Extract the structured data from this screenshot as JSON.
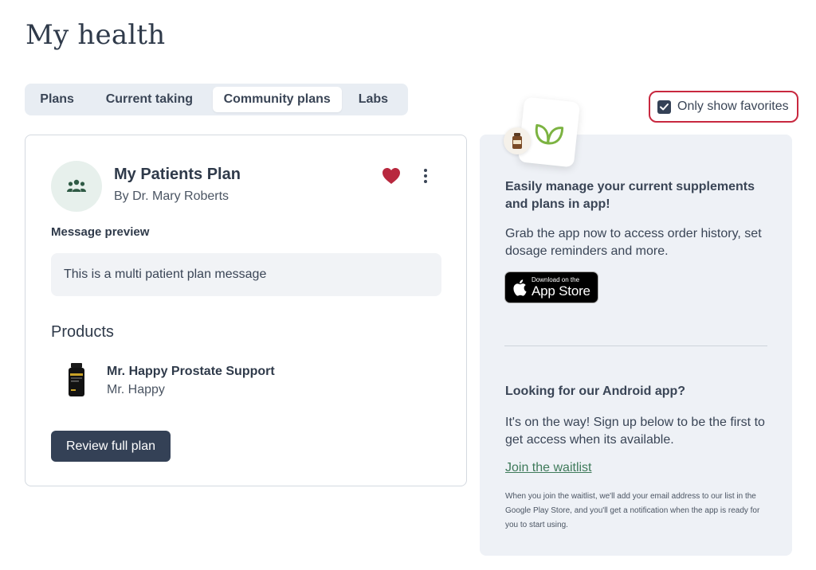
{
  "page": {
    "title": "My health"
  },
  "tabs": [
    {
      "label": "Plans"
    },
    {
      "label": "Current taking"
    },
    {
      "label": "Community plans",
      "active": true
    },
    {
      "label": "Labs"
    }
  ],
  "filter": {
    "label": "Only show favorites",
    "checked": true
  },
  "plan": {
    "name": "My Patients Plan",
    "author": "By Dr. Mary Roberts",
    "favorited": true,
    "message_heading": "Message preview",
    "message": "This is a multi patient plan message",
    "products_heading": "Products",
    "products": [
      {
        "name": "Mr. Happy Prostate Support",
        "brand": "Mr. Happy"
      }
    ],
    "review_button": "Review full plan"
  },
  "promo": {
    "heading": "Easily manage your current supplements and plans in app!",
    "text": "Grab the app now to access order history, set dosage reminders and more.",
    "appstore_small": "Download on the",
    "appstore_big": "App Store",
    "android_heading": "Looking for our Android app?",
    "android_text": "It's on the way! Sign up below to be the first to get access when its available.",
    "waitlist_link": "Join the waitlist",
    "fineprint": "When you join the waitlist, we'll add your email address to our list in the Google Play Store, and you'll get a notification when the app is ready for you to start using."
  },
  "colors": {
    "primary": "#344156",
    "heart": "#b8283e",
    "highlight_border": "#c8283f",
    "brand_green": "#3e7a5a",
    "panel_bg": "#eef1f6"
  },
  "icons": {
    "avatar": "people-group-icon",
    "favorite": "heart-icon",
    "menu": "kebab-menu-icon",
    "checkbox": "check-icon",
    "app_logo": "leaf-logo-icon",
    "appstore": "apple-icon"
  }
}
